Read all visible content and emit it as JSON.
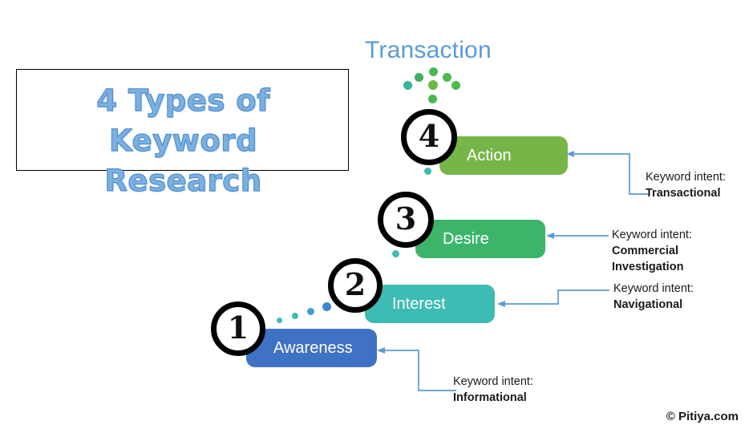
{
  "title": {
    "line1": "4 Types of Keyword",
    "line2": "Research",
    "color": "#7cb0e0"
  },
  "top_heading": {
    "label": "Transaction",
    "color": "#5b9bd5"
  },
  "stages": [
    {
      "number": "1",
      "label": "Awareness",
      "color": "#3f72c4",
      "intent_lead": "Keyword intent:",
      "intent_value": "Informational"
    },
    {
      "number": "2",
      "label": "Interest",
      "color": "#3cbcb4",
      "intent_lead": "Keyword intent:",
      "intent_value": "Navigational"
    },
    {
      "number": "3",
      "label": "Desire",
      "color": "#3cb56b",
      "intent_lead": "Keyword intent:",
      "intent_value_line1": "Commercial",
      "intent_value_line2": "Investigation"
    },
    {
      "number": "4",
      "label": "Action",
      "color": "#76b648",
      "intent_lead": "Keyword intent:",
      "intent_value": "Transactional"
    }
  ],
  "connector_color": "#5b9bd5",
  "credit": "© Pitiya.com",
  "chart_data": {
    "type": "diagram",
    "title": "4 Types of Keyword Research",
    "description": "AIDA funnel staircase mapping four marketing funnel stages to keyword search intent types",
    "stage_count": 4,
    "categories": [
      "Awareness",
      "Interest",
      "Desire",
      "Action"
    ],
    "keyword_intents": [
      "Informational",
      "Navigational",
      "Commercial Investigation",
      "Transactional"
    ],
    "stage_colors": [
      "#3f72c4",
      "#3cbcb4",
      "#3cb56b",
      "#76b648"
    ],
    "top_annotation": "Transaction"
  }
}
